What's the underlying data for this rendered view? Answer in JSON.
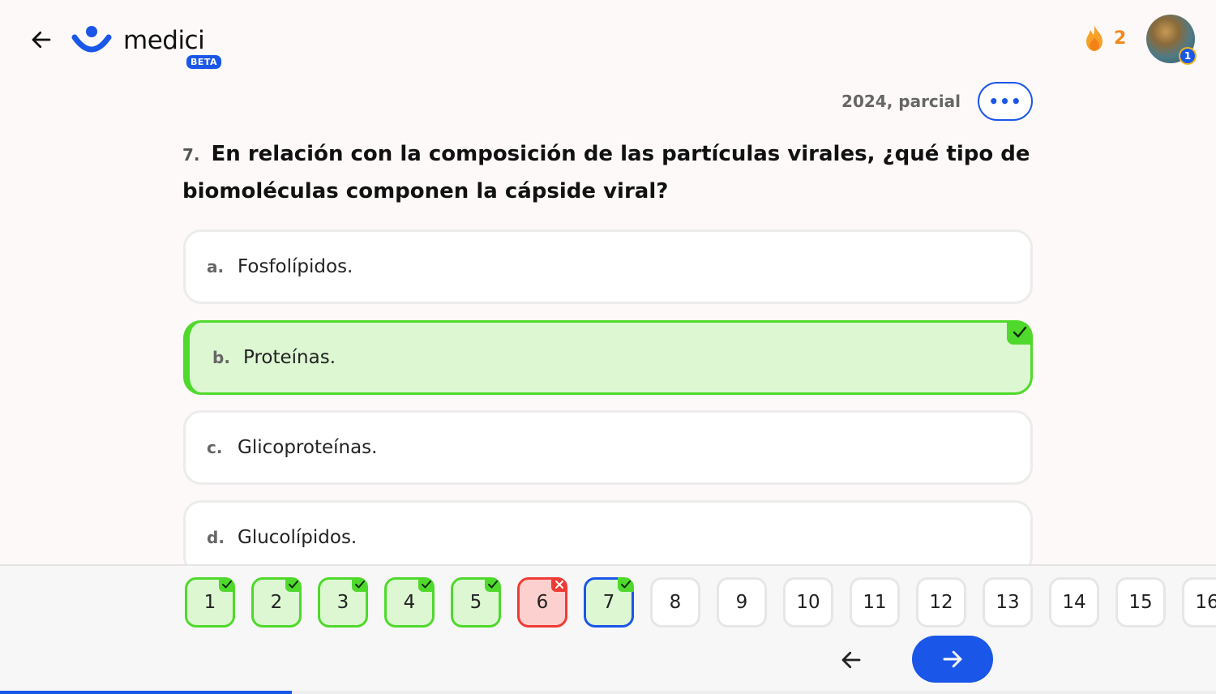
{
  "header": {
    "back_icon": "arrow-left-icon",
    "logo_text": "medici",
    "beta_label": "BETA",
    "streak_icon": "flame-icon",
    "streak_count": "2",
    "avatar_badge": "1"
  },
  "meta": {
    "source_label": "2024, parcial",
    "more_label": "•••"
  },
  "question": {
    "number": "7.",
    "text": "En relación con la composición de las partículas virales, ¿qué tipo de biomoléculas componen la cápside viral?"
  },
  "options": [
    {
      "letter": "a.",
      "text": "Fosfolípidos.",
      "state": "default"
    },
    {
      "letter": "b.",
      "text": "Proteínas.",
      "state": "correct"
    },
    {
      "letter": "c.",
      "text": "Glicoproteínas.",
      "state": "default"
    },
    {
      "letter": "d.",
      "text": "Glucolípidos.",
      "state": "default"
    }
  ],
  "navigator": {
    "items": [
      {
        "label": "1",
        "status": "correct"
      },
      {
        "label": "2",
        "status": "correct"
      },
      {
        "label": "3",
        "status": "correct"
      },
      {
        "label": "4",
        "status": "correct"
      },
      {
        "label": "5",
        "status": "correct"
      },
      {
        "label": "6",
        "status": "incorrect"
      },
      {
        "label": "7",
        "status": "current-correct"
      },
      {
        "label": "8",
        "status": "unanswered"
      },
      {
        "label": "9",
        "status": "unanswered"
      },
      {
        "label": "10",
        "status": "unanswered"
      },
      {
        "label": "11",
        "status": "unanswered"
      },
      {
        "label": "12",
        "status": "unanswered"
      },
      {
        "label": "13",
        "status": "unanswered"
      },
      {
        "label": "14",
        "status": "unanswered"
      },
      {
        "label": "15",
        "status": "unanswered"
      },
      {
        "label": "16",
        "status": "unanswered"
      }
    ],
    "prev_icon": "arrow-left-icon",
    "next_icon": "arrow-right-icon"
  },
  "progress": {
    "fraction": 0.24
  },
  "colors": {
    "accent": "#1a56e8",
    "correct": "#4fd92c",
    "incorrect": "#ef3b35",
    "streak": "#f08a1c"
  }
}
